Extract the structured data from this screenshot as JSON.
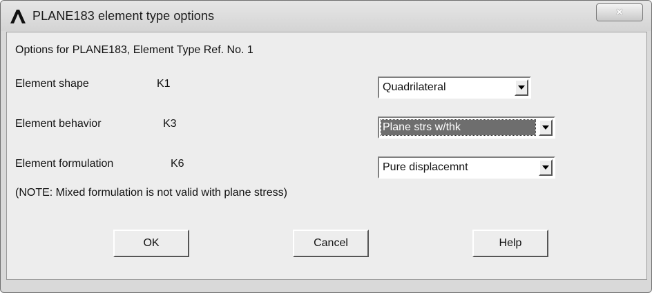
{
  "window": {
    "title": "PLANE183 element type options",
    "close_glyph": "✕"
  },
  "header": "Options for PLANE183, Element Type Ref. No. 1",
  "options": [
    {
      "label": "Element shape",
      "key": "K1",
      "value": "Quadrilateral"
    },
    {
      "label": "Element behavior",
      "key": "K3",
      "value": "Plane strs w/thk"
    },
    {
      "label": "Element formulation",
      "key": "K6",
      "value": "Pure displacemnt"
    }
  ],
  "note": "(NOTE: Mixed formulation is not valid with plane stress)",
  "buttons": {
    "ok": "OK",
    "cancel": "Cancel",
    "help": "Help"
  },
  "icons": {
    "logo": "ansys-logo-icon",
    "arrow": "dropdown-arrow-icon",
    "close": "close-icon"
  }
}
